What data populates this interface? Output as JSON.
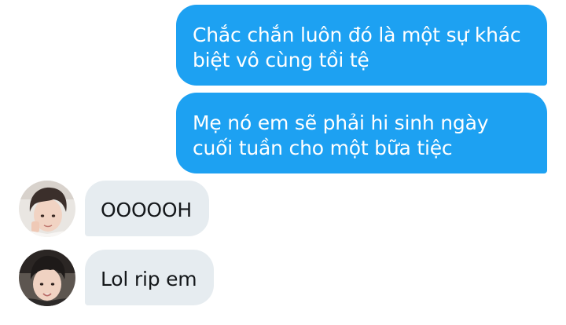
{
  "messages": [
    {
      "sender": "self",
      "lines": [
        "Chắc chắn luôn đó là một sự khác",
        "biệt vô cùng tồi tệ"
      ]
    },
    {
      "sender": "self",
      "lines": [
        "Mẹ nó em sẽ phải hi sinh ngày",
        "cuối tuần cho một bữa tiệc"
      ]
    },
    {
      "sender": "other",
      "avatar": "user-avatar-1",
      "lines": [
        "OOOOOH"
      ]
    },
    {
      "sender": "other",
      "avatar": "user-avatar-2",
      "lines": [
        "Lol rip em"
      ]
    }
  ],
  "colors": {
    "sent_bubble": "#1da1f2",
    "sent_text": "#ffffff",
    "received_bubble": "#e6ecf0",
    "received_text": "#14171a",
    "background": "#ffffff"
  }
}
